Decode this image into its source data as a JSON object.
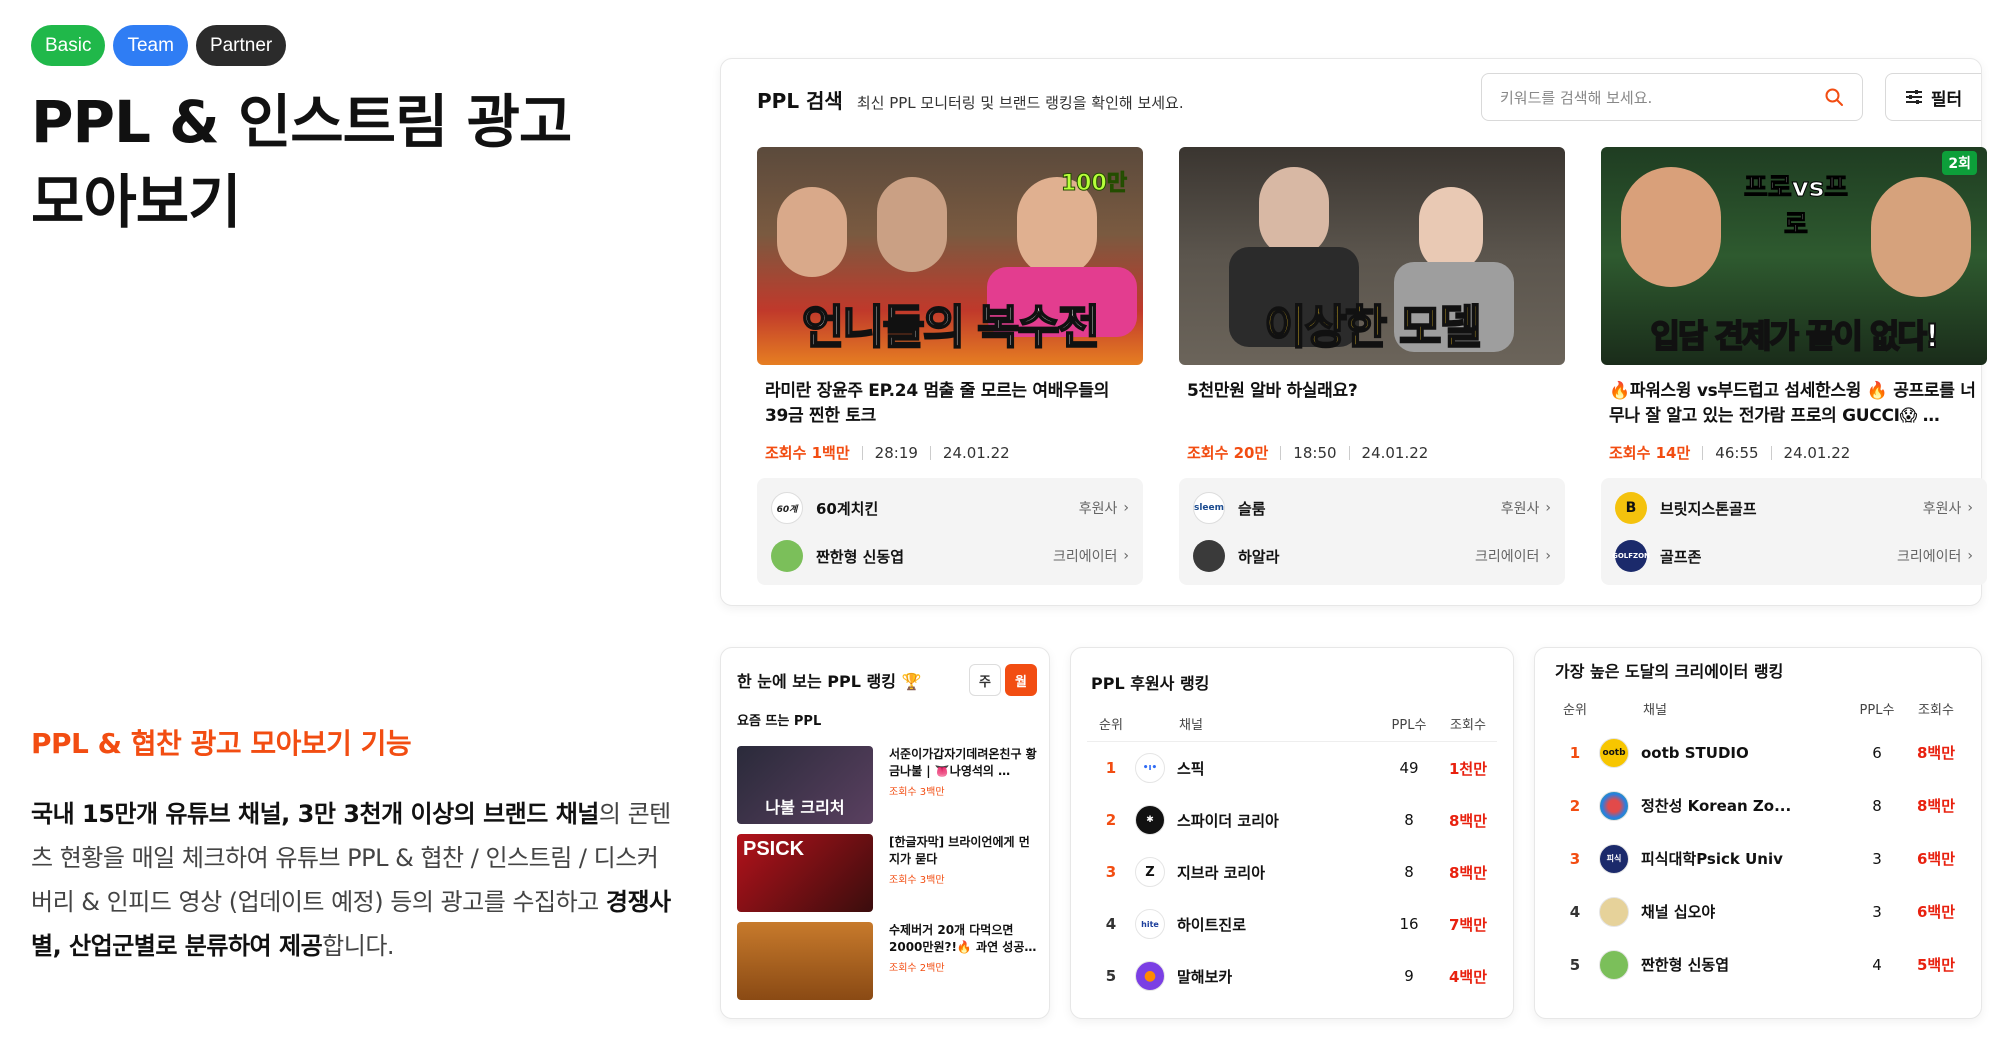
{
  "badges": [
    {
      "label": "Basic",
      "color": "#20b84a"
    },
    {
      "label": "Team",
      "color": "#2f7df4"
    },
    {
      "label": "Partner",
      "color": "#2b2b2b"
    }
  ],
  "hero": {
    "line1": "PPL & 인스트림 광고",
    "line2": "모아보기"
  },
  "feature": {
    "title": "PPL & 협찬 광고 모아보기 기능",
    "desc_bold1": "국내 15만개 유튜브 채널, 3만 3천개 이상의 브랜드 채널",
    "desc_text1": "의 콘텐츠 현황을 매일 체크하여 유튜브 PPL & 협찬 / 인스트림 / 디스커버리 & 인피드 영상 (업데이트 예정) 등의 광고를 수집하고 ",
    "desc_bold2": "경쟁사별, 산업군별로 분류하여 제공",
    "desc_text2": "합니다."
  },
  "search": {
    "title": "PPL 검색",
    "subtitle": "최신 PPL 모니터링 및 브랜드 랭킹을 확인해 보세요.",
    "placeholder": "키워드를 검색해 보세요.",
    "filter_label": "필터"
  },
  "videos": [
    {
      "thumb_text": "언니들의 복수전",
      "thumb_badge": "100만",
      "title": "라미란 장윤주 EP.24 멈출 줄 모르는 여배우들의 39금 찐한 토크",
      "views": "조회수 1백만",
      "duration": "28:19",
      "date": "24.01.22",
      "sponsor": "60계치킨",
      "sponsor_tag": "후원사",
      "creator": "짠한형 신동엽",
      "creator_tag": "크리에이터"
    },
    {
      "thumb_text": "이상한 모델",
      "thumb_badge": "",
      "title": "5천만원 알바 하실래요?",
      "views": "조회수 20만",
      "duration": "18:50",
      "date": "24.01.22",
      "sponsor": "슬룸",
      "sponsor_tag": "후원사",
      "creator": "하알라",
      "creator_tag": "크리에이터"
    },
    {
      "thumb_text": "입담 견제가 끝이 없다!",
      "thumb_badge": "2회",
      "title": "🔥파워스윙 vs부드럽고 섬세한스윙 🔥 공프로를 너무나 잘 알고 있는 전가람 프로의 GUCCI😱 …",
      "views": "조회수 14만",
      "duration": "46:55",
      "date": "24.01.22",
      "sponsor": "브릿지스톤골프",
      "sponsor_tag": "후원사",
      "creator": "골프존",
      "creator_tag": "크리에이터"
    }
  ],
  "ppl_ranking": {
    "title": "한 눈에 보는 PPL 랭킹 🏆",
    "toggle_week": "주",
    "toggle_month": "월",
    "subtitle": "요즘 뜨는 PPL",
    "items": [
      {
        "title": "서준이가갑자기데려온친구 황금나불 | 👅나영석의 …",
        "views": "조회수 3백만",
        "thumb_text": "나불 크리처"
      },
      {
        "title": "[한글자막] 브라이언에게 먼지가 묻다",
        "views": "조회수 3백만",
        "thumb_text": "PSICK"
      },
      {
        "title": "수제버거 20개 다먹으면 2000만원?!🔥 과연 성공…",
        "views": "조회수 2백만",
        "thumb_text": ""
      }
    ]
  },
  "sponsor_ranking": {
    "title": "PPL 후원사 랭킹",
    "headers": {
      "rank": "순위",
      "channel": "채널",
      "ppl": "PPL수",
      "views": "조회수"
    },
    "rows": [
      {
        "rank": "1",
        "name": "스픽",
        "ppl": "49",
        "views": "1천만",
        "logo": "•ı•"
      },
      {
        "rank": "2",
        "name": "스파이더 코리아",
        "ppl": "8",
        "views": "8백만",
        "logo": "✱"
      },
      {
        "rank": "3",
        "name": "지브라 코리아",
        "ppl": "8",
        "views": "8백만",
        "logo": "Z"
      },
      {
        "rank": "4",
        "name": "하이트진로",
        "ppl": "16",
        "views": "7백만",
        "logo": "hite"
      },
      {
        "rank": "5",
        "name": "말해보카",
        "ppl": "9",
        "views": "4백만",
        "logo": "●"
      }
    ]
  },
  "creator_ranking": {
    "title": "가장 높은 도달의 크리에이터 랭킹",
    "headers": {
      "rank": "순위",
      "channel": "채널",
      "ppl": "PPL수",
      "views": "조회수"
    },
    "rows": [
      {
        "rank": "1",
        "name": "ootb STUDIO",
        "ppl": "6",
        "views": "8백만",
        "logo": "ootb"
      },
      {
        "rank": "2",
        "name": "정찬성 Korean Zo...",
        "ppl": "8",
        "views": "8백만",
        "logo": ""
      },
      {
        "rank": "3",
        "name": "피식대학Psick Univ",
        "ppl": "3",
        "views": "6백만",
        "logo": "피식"
      },
      {
        "rank": "4",
        "name": "채널 십오야",
        "ppl": "3",
        "views": "6백만",
        "logo": ""
      },
      {
        "rank": "5",
        "name": "짠한형 신동엽",
        "ppl": "4",
        "views": "5백만",
        "logo": ""
      }
    ]
  },
  "colors": {
    "accent": "#f24d12",
    "views_red": "#e8210f"
  }
}
